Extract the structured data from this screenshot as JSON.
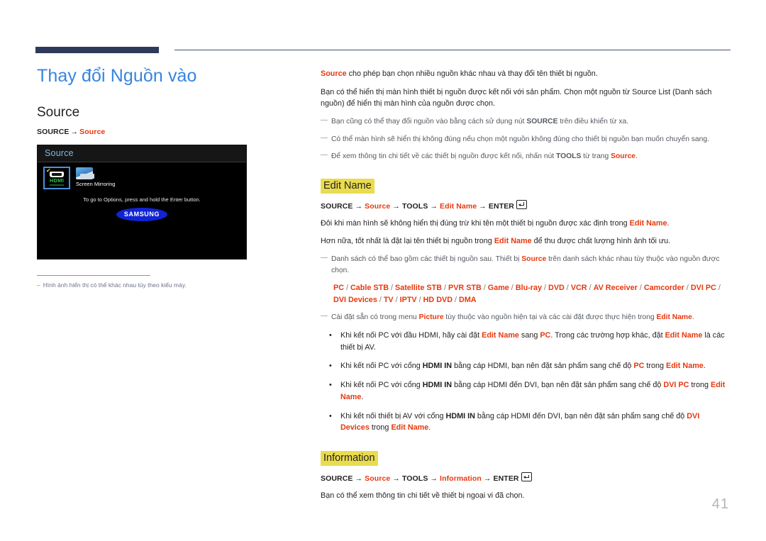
{
  "header": {
    "rule_color": "#2e3a5c"
  },
  "left": {
    "doc_title": "Thay đổi Nguồn vào",
    "section_title": "Source",
    "breadcrumb": {
      "root": "SOURCE",
      "arrow": "→",
      "target": "Source"
    },
    "tv_screenshot": {
      "header_label": "Source",
      "tiles": [
        {
          "name": "HDMI",
          "label": "HDMI",
          "selected": true,
          "checked": true
        },
        {
          "name": "Screen Mirroring",
          "label": "Screen Mirroring",
          "selected": false,
          "checked": false
        }
      ],
      "hint": "To go to Options, press and hold the Enter button.",
      "logo": "SAMSUNG"
    },
    "footnote": {
      "dash": "‒",
      "text": "Hình ảnh hiển thị có thể khác nhau tùy theo kiểu máy."
    }
  },
  "right": {
    "intro": {
      "lead_word": "Source",
      "lead_rest": " cho phép bạn chọn nhiều nguồn khác nhau và thay đổi tên thiết bị nguồn.",
      "para2": "Bạn có thể hiển thị màn hình thiết bị nguồn được kết nối với sản phẩm. Chọn một nguồn từ Source List (Danh sách nguồn) để hiển thị màn hình của nguồn được chọn."
    },
    "intro_notes": [
      {
        "before": "Bạn cũng có thể thay đổi nguồn vào bằng cách sử dụng nút ",
        "bold": "SOURCE",
        "after": " trên điều khiển từ xa."
      },
      {
        "before": "Có thể màn hình sẽ hiển thị không đúng nếu chọn một nguồn không đúng cho thiết bị nguồn bạn muốn chuyển sang.",
        "bold": "",
        "after": ""
      },
      {
        "before": "Để xem thông tin chi tiết về các thiết bị nguồn được kết nối, nhấn nút ",
        "bold": "TOOLS",
        "after": " từ trang ",
        "red_tail": "Source",
        "period": "."
      }
    ],
    "edit_name": {
      "heading": "Edit Name",
      "command": {
        "p1": "SOURCE",
        "p2": "Source",
        "p3": "TOOLS",
        "p4": "Edit Name",
        "p5": "ENTER",
        "arrow": "→"
      },
      "para1_a": "Đôi khi màn hình sẽ không hiển thị đúng trừ khi tên một thiết bị nguồn được xác định trong ",
      "para1_red": "Edit Name",
      "para1_b": ".",
      "para2_a": "Hơn nữa, tốt nhất là đặt lại tên thiết bị nguồn trong ",
      "para2_red": "Edit Name",
      "para2_b": " để thu được chất lượng hình ảnh tối ưu.",
      "note1_a": "Danh sách có thể bao gồm các thiết bị nguồn sau. Thiết bị ",
      "note1_red": "Source",
      "note1_b": " trên danh sách khác nhau tùy thuộc vào nguồn được chọn.",
      "device_list": [
        "PC",
        "Cable STB",
        "Satellite STB",
        "PVR STB",
        "Game",
        "Blu-ray",
        "DVD",
        "VCR",
        "AV Receiver",
        "Camcorder",
        "DVI PC",
        "DVI Devices",
        "TV",
        "IPTV",
        "HD DVD",
        "DMA"
      ],
      "device_separator": "/",
      "note2_a": "Cài đặt sẵn có trong menu ",
      "note2_red1": "Picture",
      "note2_b": " tùy thuộc vào nguồn hiện tại và các cài đặt được thực hiện trong ",
      "note2_red2": "Edit Name",
      "note2_c": ".",
      "bullets": [
        {
          "bullet": "•",
          "a": "Khi kết nối PC với đầu HDMI, hãy cài đặt ",
          "r1": "Edit Name",
          "b": " sang ",
          "r2": "PC",
          "c": ". Trong các trường hợp khác, đặt ",
          "r3": "Edit Name",
          "d": " là các thiết bị AV."
        },
        {
          "bullet": "•",
          "a": "Khi kết nối PC với cổng ",
          "bold1": "HDMI IN",
          "b": " bằng cáp HDMI, bạn nên đặt sản phẩm sang chế độ ",
          "r2": "PC",
          "c": " trong ",
          "r3": "Edit Name",
          "d": "."
        },
        {
          "bullet": "•",
          "a": "Khi kết nối PC với cổng ",
          "bold1": "HDMI IN",
          "b": " bằng cáp HDMI đến DVI, bạn nên đặt sản phẩm sang chế độ ",
          "r2": "DVI PC",
          "c": " trong ",
          "r3": "Edit Name",
          "d": "."
        },
        {
          "bullet": "•",
          "a": "Khi kết nối thiết bị AV với cổng ",
          "bold1": "HDMI IN",
          "b": "  bằng cáp HDMI đến DVI, bạn nên đặt sản phẩm sang chế độ ",
          "r2": "DVI Devices",
          "c": " trong ",
          "r3": "Edit Name",
          "d": "."
        }
      ]
    },
    "information": {
      "heading": "Information",
      "command": {
        "p1": "SOURCE",
        "p2": "Source",
        "p3": "TOOLS",
        "p4": "Information",
        "p5": "ENTER",
        "arrow": "→"
      },
      "para": "Bạn có thể xem thông tin chi tiết về thiết bị ngoại vi đã chọn."
    }
  },
  "page_number": "41"
}
